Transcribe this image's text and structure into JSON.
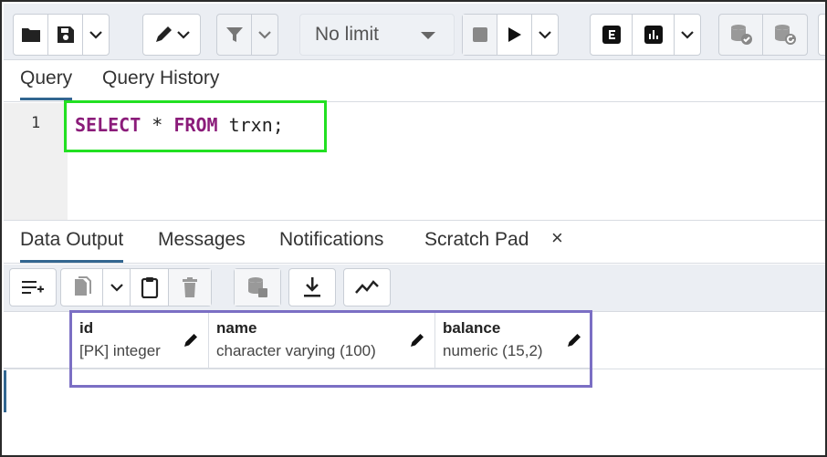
{
  "toolbar": {
    "limit_value": "No limit",
    "icons": [
      "open-file-icon",
      "save-icon",
      "chevron-down-icon",
      "edit-pen-icon",
      "filter-icon",
      "stop-icon",
      "execute-icon",
      "explain-icon",
      "explain-analyze-icon",
      "commit-icon",
      "rollback-icon"
    ]
  },
  "query_tabs": {
    "query": "Query",
    "history": "Query History"
  },
  "editor": {
    "line_number": "1",
    "code": {
      "kw1": "SELECT",
      "op": " * ",
      "kw2": "FROM",
      "rest": " trxn;"
    }
  },
  "output_tabs": {
    "data_output": "Data Output",
    "messages": "Messages",
    "notifications": "Notifications",
    "scratch_pad": "Scratch Pad",
    "close": "×"
  },
  "grid": {
    "columns": [
      {
        "name": "id",
        "type": "[PK] integer"
      },
      {
        "name": "name",
        "type": "character varying (100)"
      },
      {
        "name": "balance",
        "type": "numeric (15,2)"
      }
    ]
  },
  "colors": {
    "keyword": "#8b1c7a",
    "active_tab": "#326690",
    "highlight_green": "#22e022",
    "highlight_purple": "#7b6fc4"
  }
}
